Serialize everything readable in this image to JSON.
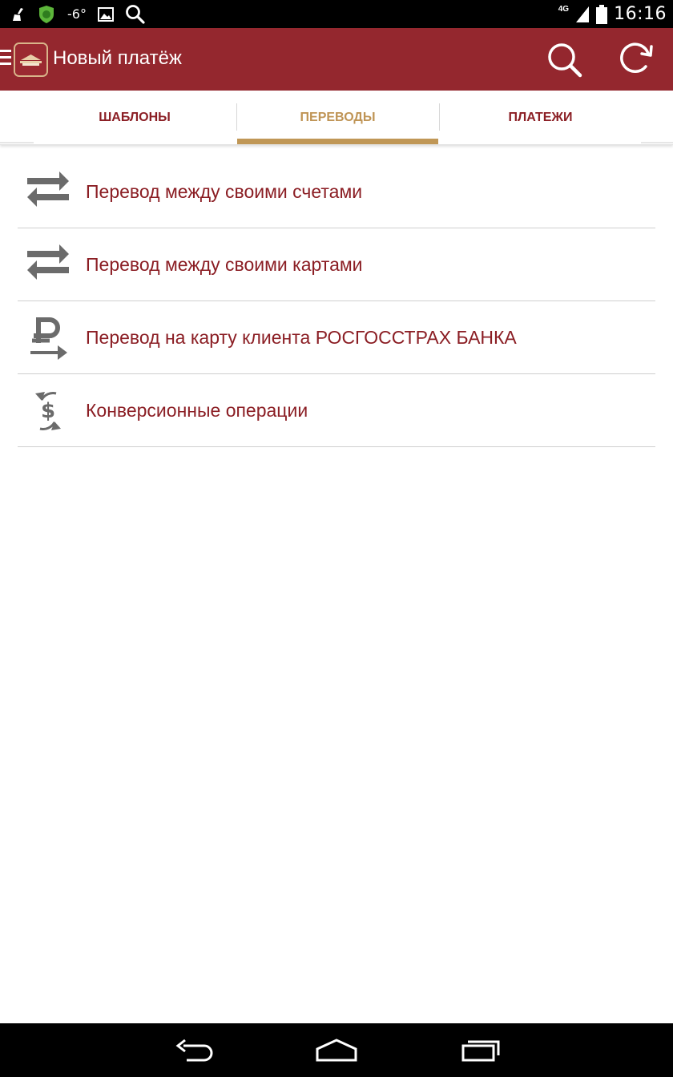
{
  "status_bar": {
    "temperature": "-6°",
    "network": "4G",
    "time": "16:16"
  },
  "app_bar": {
    "title": "Новый платёж",
    "color": "#94272e"
  },
  "tabs": [
    {
      "label": "ШАБЛОНЫ",
      "active": false
    },
    {
      "label": "ПЕРЕВОДЫ",
      "active": true
    },
    {
      "label": "ПЛАТЕЖИ",
      "active": false
    }
  ],
  "list": {
    "items": [
      {
        "icon": "transfer-arrows-icon",
        "label": "Перевод между своими счетами"
      },
      {
        "icon": "transfer-arrows-icon",
        "label": "Перевод между своими картами"
      },
      {
        "icon": "ruble-transfer-icon",
        "label": "Перевод на карту клиента РОСГОССТРАХ БАНКА"
      },
      {
        "icon": "currency-exchange-icon",
        "label": "Конверсионные операции"
      }
    ]
  },
  "colors": {
    "accent": "#c09756",
    "text_primary": "#8b1e24",
    "icon_gray": "#6b6b6b"
  }
}
